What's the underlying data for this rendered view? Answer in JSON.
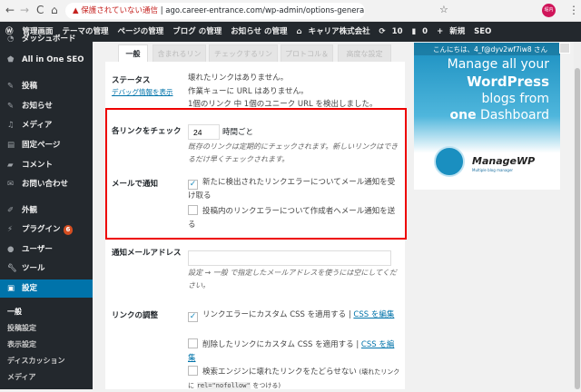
{
  "browser": {
    "back": "←",
    "forward": "→",
    "reload": "C",
    "home": "⌂",
    "security_warning": "保護されていない通信",
    "url": "ago.career-entrance.com/wp-admin/options-general.php?pag...",
    "star": "☆",
    "profile": "堀内",
    "menu": "⋮"
  },
  "adminbar": {
    "items": [
      "管理画面",
      "テーマの管理",
      "ページの管理",
      "ブログ の管理",
      "お知らせ の管理",
      "キャリア株式会社",
      "10",
      "0",
      "新規",
      "SEO"
    ],
    "greeting": "こんにちは、4_f@dyv2wf7iw8 さん"
  },
  "sidebar": {
    "items": [
      {
        "label": "ダッシュボード",
        "icon": "dashboard-icon"
      },
      {
        "label": "All in One SEO",
        "icon": "shield-icon"
      },
      {
        "label": "投稿",
        "icon": "pin-icon"
      },
      {
        "label": "お知らせ",
        "icon": "pin-icon"
      },
      {
        "label": "メディア",
        "icon": "media-icon"
      },
      {
        "label": "固定ページ",
        "icon": "page-icon"
      },
      {
        "label": "コメント",
        "icon": "comment-icon"
      },
      {
        "label": "お問い合わせ",
        "icon": "mail-icon"
      },
      {
        "label": "外観",
        "icon": "brush-icon"
      },
      {
        "label": "プラグイン",
        "icon": "plugin-icon",
        "badge": "6"
      },
      {
        "label": "ユーザー",
        "icon": "user-icon"
      },
      {
        "label": "ツール",
        "icon": "wrench-icon"
      },
      {
        "label": "設定",
        "icon": "settings-icon"
      }
    ],
    "subitems": [
      "一般",
      "投稿設定",
      "表示設定",
      "ディスカッション",
      "メディア"
    ]
  },
  "tabs": [
    "一般",
    "含まれるリン",
    "チェックするリン",
    "プロトコル＆",
    "高度な設定"
  ],
  "status": {
    "label": "ステータス",
    "debug_link": "デバッグ情報を表示",
    "lines": [
      "壊れたリンクはありません。",
      "作業キューに URL はありません。",
      "1個のリンク 中 1個のユニーク URL を検出しました。"
    ]
  },
  "check": {
    "label": "各リンクをチェック",
    "value": "24",
    "unit": "時間ごと",
    "desc": "既存のリンクは定期的にチェックされます。新しいリンクはできるだけ早くチェックされます。"
  },
  "notify": {
    "label": "メールで通知",
    "options": [
      {
        "text": "新たに検出されたリンクエラーについてメール通知を受け取る",
        "checked": true
      },
      {
        "text": "投稿内のリンクエラーについて作成者へメール通知を送る",
        "checked": false
      }
    ]
  },
  "email": {
    "label": "通知メールアドレス",
    "value": "",
    "desc": "設定 → 一般 で指定したメールアドレスを使うには空にしてください。"
  },
  "tweaks": {
    "label": "リンクの調整",
    "options": [
      {
        "text": "リンクエラーにカスタム CSS を適用する",
        "link": "CSS を編集",
        "checked": true
      },
      {
        "text": "削除したリンクにカスタム CSS を適用する",
        "link": "CSS を編集",
        "checked": false
      },
      {
        "text": "検索エンジンに壊れたリンクをたどらせない",
        "note": "(壊れたリンクに",
        "code": "rel=\"nofollow\"",
        "note2": "をつける)",
        "checked": false
      }
    ]
  },
  "ad": {
    "lines": [
      "Manage all your",
      "WordPress",
      "blogs from",
      "one",
      "Dashboard"
    ],
    "brand": "ManageWP",
    "tagline": "Multiple blog manager"
  },
  "colors": {
    "adminbar": "#23282d",
    "accent": "#0073aa",
    "highlight": "#e00000"
  }
}
